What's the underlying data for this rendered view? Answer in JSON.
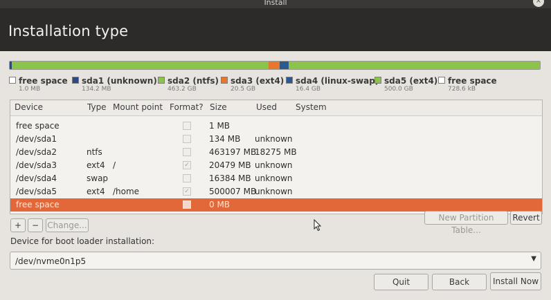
{
  "window": {
    "title": "Install",
    "close_glyph": "×"
  },
  "header": {
    "title": "Installation type"
  },
  "partition_bar": {
    "segments": [
      {
        "name": "free space",
        "fraction": 0.0,
        "color": "#ffffff"
      },
      {
        "name": "sda1",
        "fraction": 0.004,
        "color": "#2a4a80"
      },
      {
        "name": "sda2",
        "fraction": 0.484,
        "color": "#8cc34a"
      },
      {
        "name": "sda3",
        "fraction": 0.021,
        "color": "#e8772e"
      },
      {
        "name": "sda4",
        "fraction": 0.017,
        "color": "#2c5a8e"
      },
      {
        "name": "sda5",
        "fraction": 0.474,
        "color": "#8cc34a"
      }
    ]
  },
  "legend": [
    {
      "name": "free space",
      "size": "1.0 MB",
      "color": "#ffffff"
    },
    {
      "name": "sda1 (unknown)",
      "size": "134.2 MB",
      "color": "#2a4a80"
    },
    {
      "name": "sda2 (ntfs)",
      "size": "463.2 GB",
      "color": "#8cc34a"
    },
    {
      "name": "sda3 (ext4)",
      "size": "20.5 GB",
      "color": "#e8772e"
    },
    {
      "name": "sda4 (linux-swap)",
      "size": "16.4 GB",
      "color": "#2c5a8e"
    },
    {
      "name": "sda5 (ext4)",
      "size": "500.0 GB",
      "color": "#8cc34a"
    },
    {
      "name": "free space",
      "size": "728.6 kB",
      "color": "#ffffff"
    }
  ],
  "table": {
    "columns": [
      "Device",
      "Type",
      "Mount point",
      "Format?",
      "Size",
      "Used",
      "System"
    ],
    "rows": [
      {
        "device": "free space",
        "type": "",
        "mount": "",
        "format": false,
        "size": "1 MB",
        "used": ""
      },
      {
        "device": "/dev/sda1",
        "type": "",
        "mount": "",
        "format": false,
        "size": "134 MB",
        "used": "unknown"
      },
      {
        "device": "/dev/sda2",
        "type": "ntfs",
        "mount": "",
        "format": false,
        "size": "463197 MB",
        "used": "18275 MB"
      },
      {
        "device": "/dev/sda3",
        "type": "ext4",
        "mount": "/",
        "format": true,
        "size": "20479 MB",
        "used": "unknown"
      },
      {
        "device": "/dev/sda4",
        "type": "swap",
        "mount": "",
        "format": false,
        "size": "16384 MB",
        "used": "unknown"
      },
      {
        "device": "/dev/sda5",
        "type": "ext4",
        "mount": "/home",
        "format": true,
        "size": "500007 MB",
        "used": "unknown"
      },
      {
        "device": "free space",
        "type": "",
        "mount": "",
        "format": false,
        "size": "0 MB",
        "used": "",
        "selected": true
      }
    ],
    "check_glyph": "✓"
  },
  "actions": {
    "add": "+",
    "remove": "−",
    "change": "Change...",
    "new_table": "New Partition Table...",
    "revert": "Revert"
  },
  "bootloader": {
    "label": "Device for boot loader installation:",
    "value": "/dev/nvme0n1p5",
    "arrow_glyph": "▼"
  },
  "footer": {
    "quit": "Quit",
    "back": "Back",
    "install": "Install Now"
  },
  "colors": {
    "selected_row": "#e2683a",
    "header_bg": "#2d2b29"
  }
}
